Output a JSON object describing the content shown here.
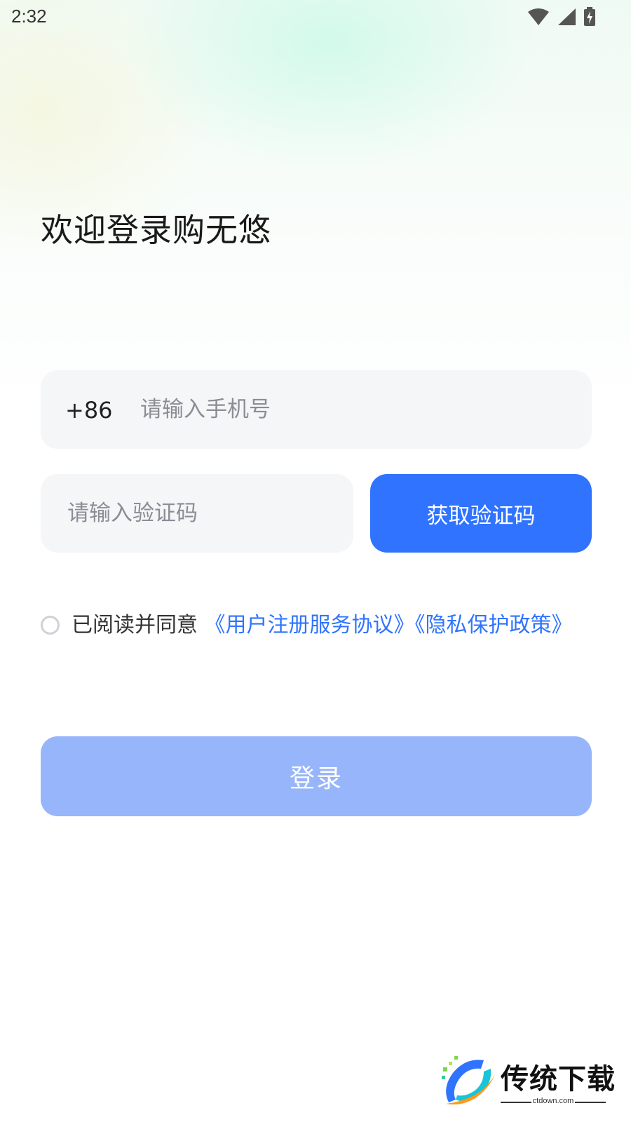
{
  "status_bar": {
    "time": "2:32",
    "icons": [
      "wifi-icon",
      "cellular-signal-icon",
      "battery-charging-icon"
    ]
  },
  "welcome_title": "欢迎登录购无悠",
  "phone": {
    "country_code": "+86",
    "placeholder": "请输入手机号",
    "value": ""
  },
  "verification": {
    "placeholder": "请输入验证码",
    "value": "",
    "get_code_label": "获取验证码"
  },
  "agreement": {
    "checked": false,
    "prefix": "已阅读并同意 ",
    "terms_link": "《用户注册服务协议》",
    "privacy_link": "《隐私保护政策》"
  },
  "login_label": "登录",
  "watermark": {
    "brand": "传统下载",
    "url": "ctdown.com"
  },
  "colors": {
    "primary": "#2f73ff",
    "login_disabled": "#97b5fb",
    "field_bg": "#f5f6f8"
  }
}
